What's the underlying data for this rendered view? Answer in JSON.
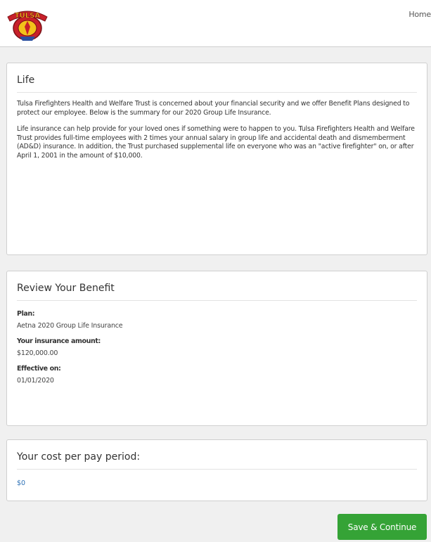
{
  "nav": {
    "home_label": "Home",
    "logo_text": "TULSA"
  },
  "life": {
    "title": "Life",
    "paragraph1": "Tulsa Firefighters Health and Welfare Trust is concerned about your financial security and we offer Benefit Plans designed to protect our employee.  Below is the summary for our 2020 Group Life Insurance.",
    "paragraph2": "Life insurance can help provide for your loved ones if something were to happen to you. Tulsa Firefighters Health and Welfare Trust provides full-time employees with 2 times your annual salary in group life and accidental death and dismemberment (AD&D) insurance.  In addition, the Trust purchased supplemental life on everyone who was an \"active firefighter\" on, or after April 1, 2001 in the amount of $10,000."
  },
  "review": {
    "title": "Review Your Benefit",
    "plan_label": "Plan:",
    "plan_value": "Aetna 2020 Group Life Insurance",
    "amount_label": "Your insurance amount:",
    "amount_value": "$120,000.00",
    "effective_label": "Effective on:",
    "effective_value": "01/01/2020"
  },
  "cost": {
    "title": "Your cost per pay period:",
    "value": "$0"
  },
  "actions": {
    "save_label": "Save & Continue"
  },
  "colors": {
    "button_green": "#35a336",
    "cost_blue": "#2a6fb5",
    "logo_red": "#c8202a",
    "logo_yellow": "#f3c21a"
  }
}
